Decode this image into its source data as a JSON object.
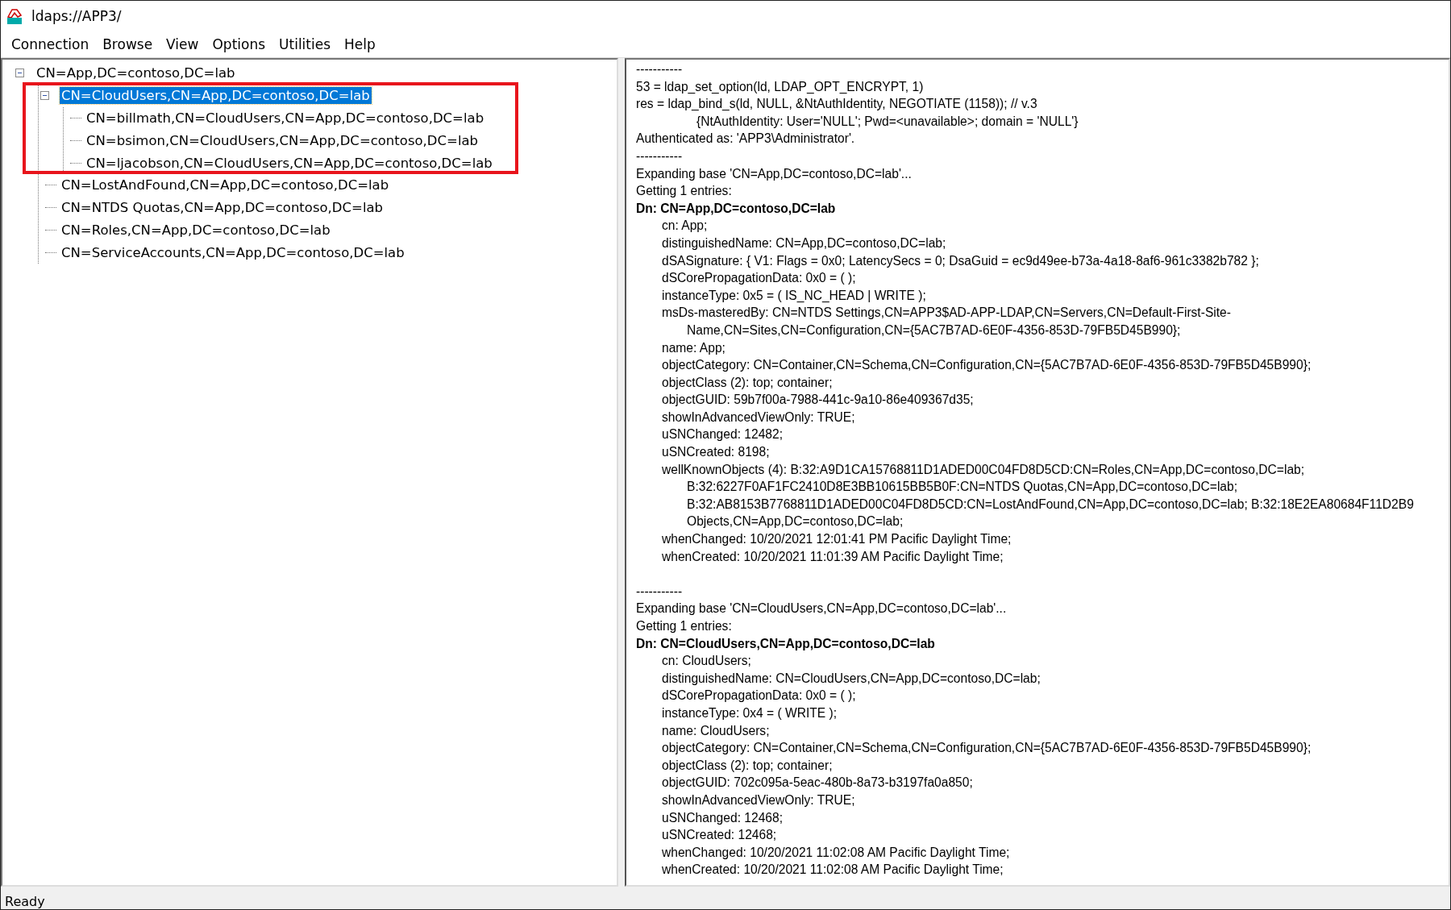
{
  "window": {
    "title": "ldaps://APP3/"
  },
  "menu": [
    "Connection",
    "Browse",
    "View",
    "Options",
    "Utilities",
    "Help"
  ],
  "tree": [
    {
      "label": "CN=App,DC=contoso,DC=lab",
      "selected": false,
      "expanded": true,
      "highlighted": false,
      "children": [
        {
          "label": "CN=CloudUsers,CN=App,DC=contoso,DC=lab",
          "selected": true,
          "expanded": true,
          "highlighted": true,
          "children": [
            {
              "label": "CN=billmath,CN=CloudUsers,CN=App,DC=contoso,DC=lab",
              "selected": false,
              "highlighted": false
            },
            {
              "label": "CN=bsimon,CN=CloudUsers,CN=App,DC=contoso,DC=lab",
              "selected": false,
              "highlighted": false
            },
            {
              "label": "CN=ljacobson,CN=CloudUsers,CN=App,DC=contoso,DC=lab",
              "selected": false,
              "highlighted": false
            }
          ]
        },
        {
          "label": "CN=LostAndFound,CN=App,DC=contoso,DC=lab",
          "selected": false,
          "highlighted": false
        },
        {
          "label": "CN=NTDS Quotas,CN=App,DC=contoso,DC=lab",
          "selected": false,
          "highlighted": false
        },
        {
          "label": "CN=Roles,CN=App,DC=contoso,DC=lab",
          "selected": false,
          "highlighted": false
        },
        {
          "label": "CN=ServiceAccounts,CN=App,DC=contoso,DC=lab",
          "selected": false,
          "highlighted": false
        }
      ]
    }
  ],
  "log": [
    {
      "kind": "plain",
      "text": "-----------"
    },
    {
      "kind": "plain",
      "text": "53 = ldap_set_option(ld, LDAP_OPT_ENCRYPT, 1)"
    },
    {
      "kind": "plain",
      "text": "res = ldap_bind_s(ld, NULL, &NtAuthIdentity, NEGOTIATE (1158)); // v.3"
    },
    {
      "kind": "detail",
      "text": "{NtAuthIdentity: User='NULL'; Pwd=<unavailable>; domain = 'NULL'}"
    },
    {
      "kind": "plain",
      "text": "Authenticated as: 'APP3\\Administrator'."
    },
    {
      "kind": "plain",
      "text": "-----------"
    },
    {
      "kind": "plain",
      "text": "Expanding base 'CN=App,DC=contoso,DC=lab'..."
    },
    {
      "kind": "plain",
      "text": "Getting 1 entries:"
    },
    {
      "kind": "dn",
      "text": "Dn: CN=App,DC=contoso,DC=lab"
    },
    {
      "kind": "attr",
      "text": "cn: App;"
    },
    {
      "kind": "attr",
      "text": "distinguishedName: CN=App,DC=contoso,DC=lab;"
    },
    {
      "kind": "attr",
      "text": "dSASignature: { V1: Flags = 0x0; LatencySecs = 0; DsaGuid = ec9d49ee-b73a-4a18-8af6-961c3382b782 };"
    },
    {
      "kind": "attr",
      "text": "dSCorePropagationData: 0x0 = (  );"
    },
    {
      "kind": "attr",
      "text": "instanceType: 0x5 = ( IS_NC_HEAD | WRITE );"
    },
    {
      "kind": "attr",
      "text": "msDs-masteredBy: CN=NTDS Settings,CN=APP3$AD-APP-LDAP,CN=Servers,CN=Default-First-Site-"
    },
    {
      "kind": "cont",
      "text": "Name,CN=Sites,CN=Configuration,CN={5AC7B7AD-6E0F-4356-853D-79FB5D45B990};"
    },
    {
      "kind": "attr",
      "text": "name: App;"
    },
    {
      "kind": "attr",
      "text": "objectCategory: CN=Container,CN=Schema,CN=Configuration,CN={5AC7B7AD-6E0F-4356-853D-79FB5D45B990};"
    },
    {
      "kind": "attr",
      "text": "objectClass (2): top; container;"
    },
    {
      "kind": "attr",
      "text": "objectGUID: 59b7f00a-7988-441c-9a10-86e409367d35;"
    },
    {
      "kind": "attr",
      "text": "showInAdvancedViewOnly: TRUE;"
    },
    {
      "kind": "attr",
      "text": "uSNChanged: 12482;"
    },
    {
      "kind": "attr",
      "text": "uSNCreated: 8198;"
    },
    {
      "kind": "attr",
      "text": "wellKnownObjects (4): B:32:A9D1CA15768811D1ADED00C04FD8D5CD:CN=Roles,CN=App,DC=contoso,DC=lab;"
    },
    {
      "kind": "cont",
      "text": "B:32:6227F0AF1FC2410D8E3BB10615BB5B0F:CN=NTDS Quotas,CN=App,DC=contoso,DC=lab;"
    },
    {
      "kind": "cont",
      "text": "B:32:AB8153B7768811D1ADED00C04FD8D5CD:CN=LostAndFound,CN=App,DC=contoso,DC=lab; B:32:18E2EA80684F11D2B9"
    },
    {
      "kind": "cont",
      "text": "Objects,CN=App,DC=contoso,DC=lab;"
    },
    {
      "kind": "attr",
      "text": "whenChanged: 10/20/2021 12:01:41 PM Pacific Daylight Time;"
    },
    {
      "kind": "attr",
      "text": "whenCreated: 10/20/2021 11:01:39 AM Pacific Daylight Time;"
    },
    {
      "kind": "blank"
    },
    {
      "kind": "plain",
      "text": "-----------"
    },
    {
      "kind": "plain",
      "text": "Expanding base 'CN=CloudUsers,CN=App,DC=contoso,DC=lab'..."
    },
    {
      "kind": "plain",
      "text": "Getting 1 entries:"
    },
    {
      "kind": "dn",
      "text": "Dn: CN=CloudUsers,CN=App,DC=contoso,DC=lab"
    },
    {
      "kind": "attr",
      "text": "cn: CloudUsers;"
    },
    {
      "kind": "attr",
      "text": "distinguishedName: CN=CloudUsers,CN=App,DC=contoso,DC=lab;"
    },
    {
      "kind": "attr",
      "text": "dSCorePropagationData: 0x0 = (  );"
    },
    {
      "kind": "attr",
      "text": "instanceType: 0x4 = ( WRITE );"
    },
    {
      "kind": "attr",
      "text": "name: CloudUsers;"
    },
    {
      "kind": "attr",
      "text": "objectCategory: CN=Container,CN=Schema,CN=Configuration,CN={5AC7B7AD-6E0F-4356-853D-79FB5D45B990};"
    },
    {
      "kind": "attr",
      "text": "objectClass (2): top; container;"
    },
    {
      "kind": "attr",
      "text": "objectGUID: 702c095a-5eac-480b-8a73-b3197fa0a850;"
    },
    {
      "kind": "attr",
      "text": "showInAdvancedViewOnly: TRUE;"
    },
    {
      "kind": "attr",
      "text": "uSNChanged: 12468;"
    },
    {
      "kind": "attr",
      "text": "uSNCreated: 12468;"
    },
    {
      "kind": "attr",
      "text": "whenChanged: 10/20/2021 11:02:08 AM Pacific Daylight Time;"
    },
    {
      "kind": "attr",
      "text": "whenCreated: 10/20/2021 11:02:08 AM Pacific Daylight Time;"
    }
  ],
  "status_bar": "Ready"
}
